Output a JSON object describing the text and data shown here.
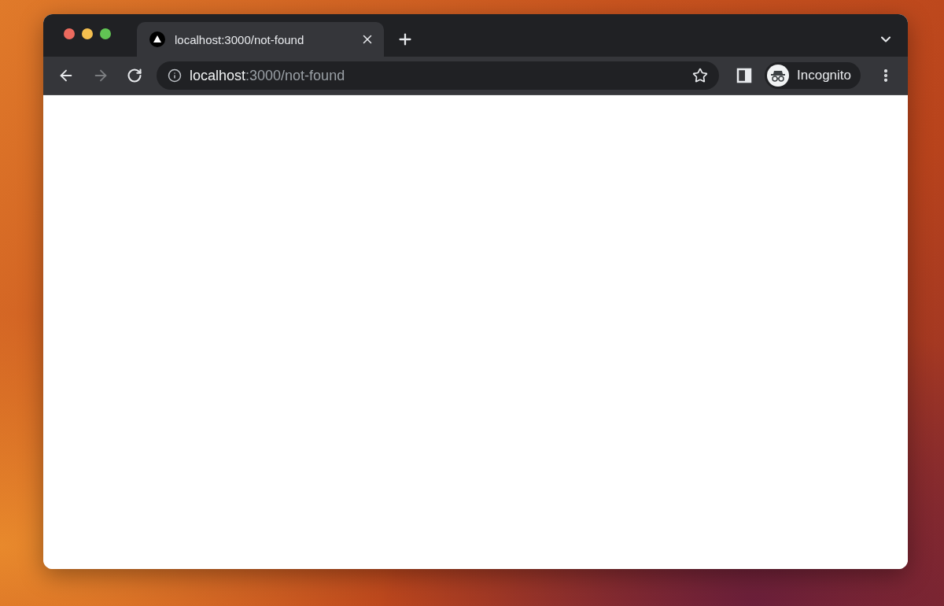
{
  "tabs": [
    {
      "title": "localhost:3000/not-found",
      "selected": true
    }
  ],
  "toolbar": {
    "back": {
      "disabled": false
    },
    "forward": {
      "disabled": true
    }
  },
  "address_bar": {
    "host": "localhost",
    "path": ":3000/not-found"
  },
  "profile": {
    "label": "Incognito"
  }
}
